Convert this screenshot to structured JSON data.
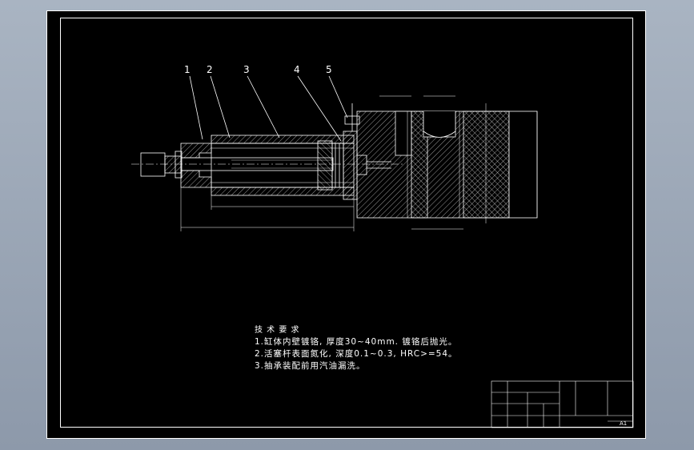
{
  "part_labels": [
    "1",
    "2",
    "3",
    "4",
    "5"
  ],
  "technical_requirements": {
    "title": "技 术 要 求",
    "items": [
      "1.缸体内壁镀铬, 厚度30~40mm. 镀铬后抛光。",
      "2.活塞杆表面氮化, 深度0.1~0.3, HRC>=54。",
      "3.抽承装配前用汽油漏洗。"
    ]
  },
  "title_block": {
    "sheet_size": "A1"
  },
  "colors": {
    "background": "#000000",
    "lines": "#ffffff",
    "frame_outer": "#9aa6b5"
  }
}
